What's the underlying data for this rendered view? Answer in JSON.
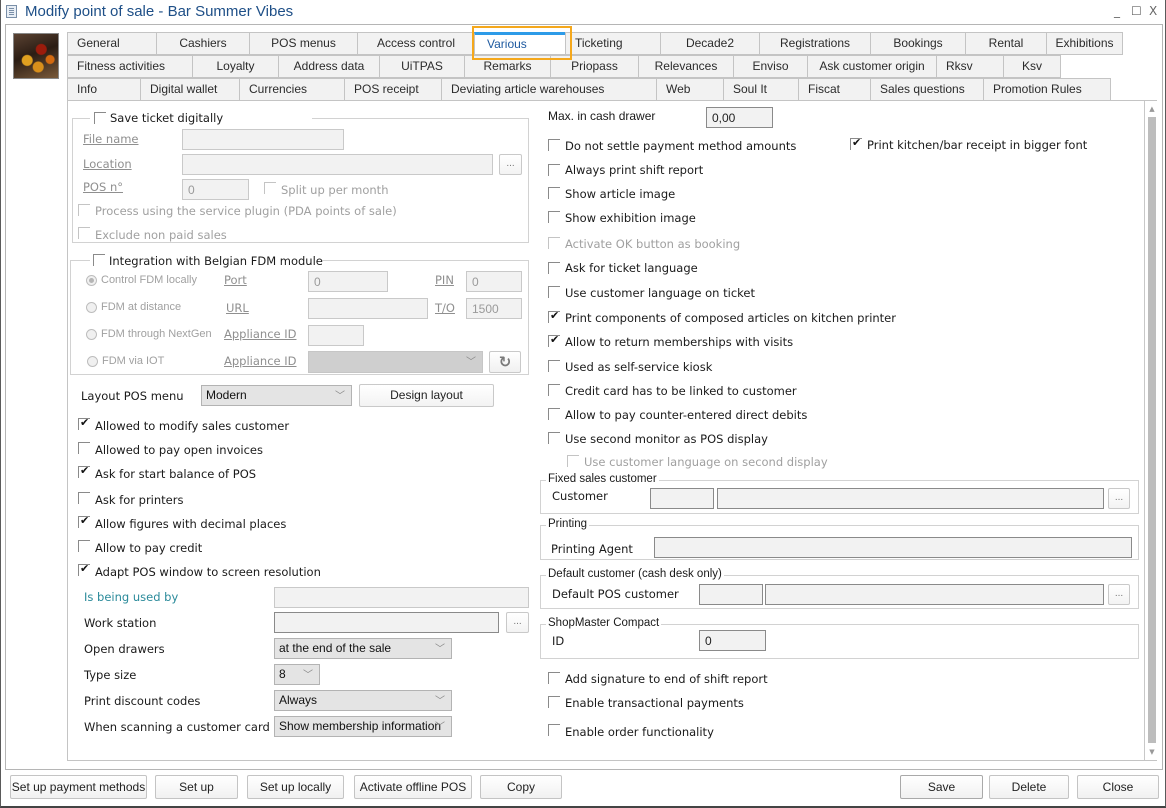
{
  "window": {
    "title": "Modify point of sale - Bar Summer Vibes",
    "controls": {
      "minimize": "_",
      "maximize": "☐",
      "close": "X"
    }
  },
  "tabs": {
    "row1": [
      "General",
      "Cashiers",
      "POS menus",
      "Access control",
      "Various",
      "Ticketing",
      "Decade2",
      "Registrations",
      "Bookings",
      "Rental",
      "Exhibitions"
    ],
    "row2": [
      "Fitness activities",
      "Loyalty",
      "Address data",
      "UiTPAS",
      "Remarks",
      "Priopass",
      "Relevances",
      "Enviso",
      "Ask customer origin",
      "Rksv",
      "Ksv"
    ],
    "row3": [
      "Info",
      "Digital wallet",
      "Currencies",
      "POS receipt",
      "Deviating article warehouses",
      "Web",
      "Soul It",
      "Fiscat",
      "Sales questions",
      "Promotion Rules"
    ],
    "active": "Various"
  },
  "save_ticket": {
    "title": "Save ticket digitally",
    "checked": false,
    "file_name_label": "File name",
    "file_name_value": "",
    "location_label": "Location",
    "location_value": "",
    "browse_label": "...",
    "pos_no_label": "POS n°",
    "pos_no_value": "0",
    "split_label": "Split up per month",
    "split_checked": false,
    "service_plugin_label": "Process using the service plugin (PDA points of sale)",
    "service_plugin_checked": false,
    "exclude_label": "Exclude non paid sales",
    "exclude_checked": false
  },
  "fdm": {
    "title": "Integration with Belgian FDM module",
    "checked": false,
    "options": [
      {
        "label": "Control FDM locally",
        "selected": true
      },
      {
        "label": "FDM at distance",
        "selected": false
      },
      {
        "label": "FDM through NextGen",
        "selected": false
      },
      {
        "label": "FDM via IOT",
        "selected": false
      }
    ],
    "port_label": "Port",
    "port_value": "0",
    "pin_label": "PIN",
    "pin_value": "0",
    "url_label": "URL",
    "url_value": "",
    "to_label": "T/O",
    "to_value": "1500",
    "appliance_label": "Appliance ID",
    "appliance_value": "",
    "appliance_iot_label": "Appliance ID",
    "appliance_iot_value": "",
    "refresh_icon": "↻"
  },
  "layout_menu": {
    "label": "Layout POS menu",
    "value": "Modern",
    "design_button": "Design layout"
  },
  "left_checks": [
    {
      "label": "Allowed to modify sales customer",
      "checked": true
    },
    {
      "label": "Allowed to pay open invoices",
      "checked": false
    },
    {
      "label": "Ask for start balance of POS",
      "checked": true
    },
    {
      "label": "Ask for printers",
      "checked": false
    },
    {
      "label": "Allow figures with decimal places",
      "checked": true
    },
    {
      "label": "Allow to pay credit",
      "checked": false
    },
    {
      "label": "Adapt POS window to screen resolution",
      "checked": true
    }
  ],
  "left_fields": {
    "used_by_label": "Is being used by",
    "used_by_value": "",
    "workstation_label": "Work station",
    "workstation_value": "",
    "workstation_browse": "...",
    "open_drawers_label": "Open drawers",
    "open_drawers_value": "at the end of the sale",
    "type_size_label": "Type size",
    "type_size_value": "8",
    "discount_label": "Print discount codes",
    "discount_value": "Always",
    "scan_label": "When scanning a customer card",
    "scan_value": "Show membership information"
  },
  "right": {
    "max_cash_label": "Max. in cash drawer",
    "max_cash_value": "0,00",
    "bigger_font_label": "Print kitchen/bar receipt in bigger font",
    "bigger_font_checked": true,
    "checks": [
      {
        "label": "Do not settle payment method amounts",
        "checked": false,
        "disabled": false
      },
      {
        "label": "Always print shift report",
        "checked": false,
        "disabled": false
      },
      {
        "label": "Show article image",
        "checked": false,
        "disabled": false
      },
      {
        "label": "Show exhibition image",
        "checked": false,
        "disabled": false
      },
      {
        "label": "Activate OK button as booking",
        "checked": false,
        "disabled": true
      },
      {
        "label": "Ask for ticket language",
        "checked": false,
        "disabled": false
      },
      {
        "label": "Use customer language on ticket",
        "checked": false,
        "disabled": false
      },
      {
        "label": "Print components of composed articles on kitchen printer",
        "checked": true,
        "disabled": false
      },
      {
        "label": "Allow to return memberships with visits",
        "checked": true,
        "disabled": false
      },
      {
        "label": "Used as self-service kiosk",
        "checked": false,
        "disabled": false
      },
      {
        "label": "Credit card has to be linked to customer",
        "checked": false,
        "disabled": false
      },
      {
        "label": "Allow to pay counter-entered direct debits",
        "checked": false,
        "disabled": false
      },
      {
        "label": "Use second monitor as POS display",
        "checked": false,
        "disabled": false
      },
      {
        "label": "Use customer language on second display",
        "checked": false,
        "disabled": true
      }
    ],
    "fixed_customer": {
      "title": "Fixed sales customer",
      "label": "Customer",
      "code": "",
      "name": "",
      "browse": "..."
    },
    "printing": {
      "title": "Printing",
      "label": "Printing Agent",
      "value": ""
    },
    "default_customer": {
      "title": "Default customer (cash desk only)",
      "label": "Default POS customer",
      "code": "",
      "name": "",
      "browse": "..."
    },
    "shopmaster": {
      "title": "ShopMaster Compact",
      "label": "ID",
      "value": "0"
    },
    "bottom_checks": [
      {
        "label": "Add signature to end of shift report",
        "checked": false
      },
      {
        "label": "Enable transactional payments",
        "checked": false
      },
      {
        "label": "Enable order functionality",
        "checked": false
      }
    ]
  },
  "footer": {
    "left_buttons": [
      "Set up payment methods",
      "Set up",
      "Set up locally",
      "Activate offline POS",
      "Copy"
    ],
    "save": "Save",
    "delete": "Delete",
    "close": "Close"
  }
}
